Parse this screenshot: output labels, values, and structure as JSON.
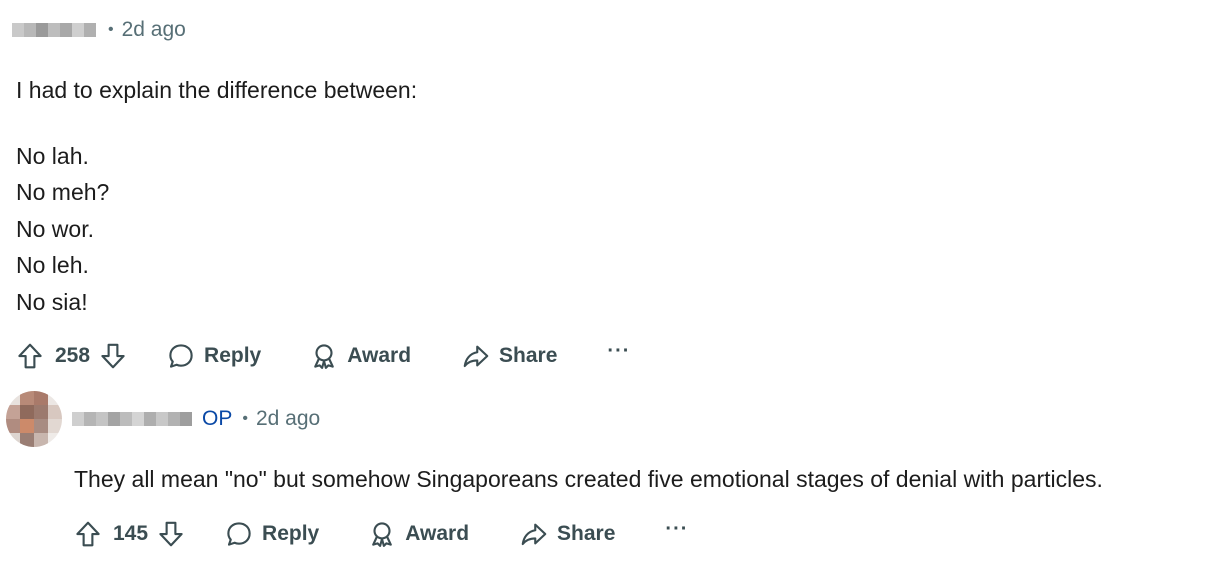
{
  "comment1": {
    "time": "2d ago",
    "intro": "I had to explain the difference between:",
    "lines": [
      "No lah.",
      "No meh?",
      "No wor.",
      "No leh.",
      "No sia!"
    ],
    "votes": "258",
    "reply_label": "Reply",
    "award_label": "Award",
    "share_label": "Share",
    "more_label": "···"
  },
  "comment2": {
    "op_badge": "OP",
    "time": "2d ago",
    "text": "They all mean \"no\" but somehow Singaporeans created five emotional stages of denial with particles.",
    "votes": "145",
    "reply_label": "Reply",
    "award_label": "Award",
    "share_label": "Share",
    "more_label": "···"
  },
  "icons": {
    "upvote": "upvote-arrow-icon",
    "downvote": "downvote-arrow-icon",
    "reply": "speech-bubble-icon",
    "award": "award-ribbon-icon",
    "share": "share-arrow-icon",
    "more": "ellipsis-icon"
  },
  "colors": {
    "text": "#1c1c1c",
    "meta": "#576f76",
    "op": "#0a49a6",
    "actions": "#3b4d52"
  }
}
